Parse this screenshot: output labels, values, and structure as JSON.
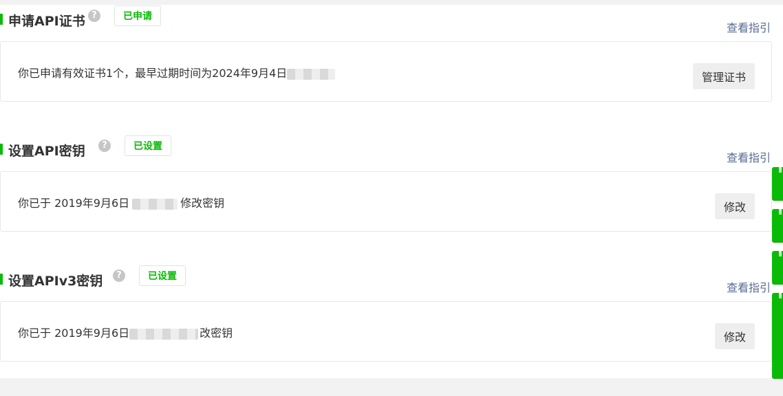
{
  "sections": [
    {
      "title": "申请API证书",
      "badge": "已申请",
      "guide_link": "查看指引",
      "card_text_before": "你已申请有效证书1个，最早过期时间为2024年9月4日",
      "card_text_after": "",
      "button_label": "管理证书"
    },
    {
      "title": "设置API密钥",
      "badge": "已设置",
      "guide_link": "查看指引",
      "card_text_before": "你已于 2019年9月6日",
      "card_text_after": "修改密钥",
      "button_label": "修改"
    },
    {
      "title": "设置APIv3密钥",
      "badge": "已设置",
      "guide_link": "查看指引",
      "card_text_before": "你已于 2019年9月6日",
      "card_text_after": "改密钥",
      "button_label": "修改"
    }
  ],
  "help_icon": {
    "glyph": "?",
    "name": "question-circle-icon"
  },
  "accent_color": "#09bb07",
  "link_color": "#576b95"
}
